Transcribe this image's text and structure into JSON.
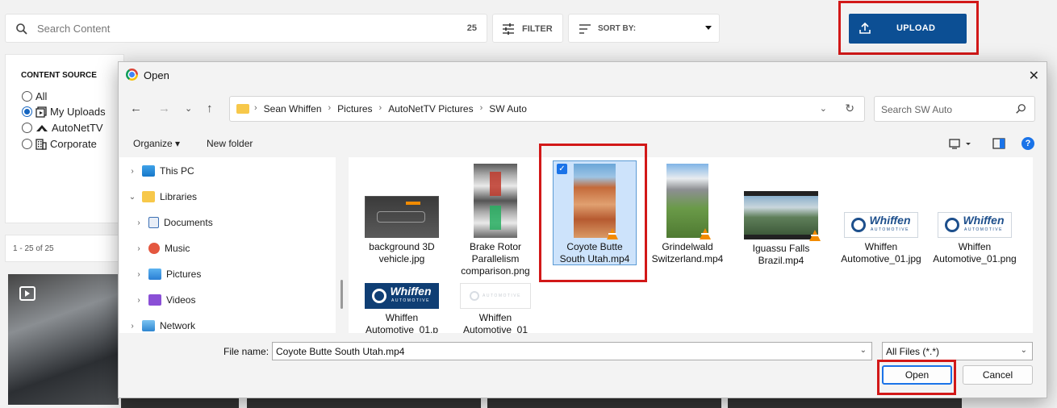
{
  "app": {
    "search": {
      "placeholder": "Search Content",
      "count": "25"
    },
    "filter_label": "FILTER",
    "sort_label": "SORT BY:",
    "upload_label": "UPLOAD",
    "content_source": {
      "title": "CONTENT SOURCE",
      "options": [
        {
          "label": "All",
          "selected": false,
          "icon": "none"
        },
        {
          "label": "My Uploads",
          "selected": true,
          "icon": "uploads-icon"
        },
        {
          "label": "AutoNetTV",
          "selected": false,
          "icon": "autonettv-icon"
        },
        {
          "label": "Corporate",
          "selected": false,
          "icon": "building-icon"
        }
      ]
    },
    "pager_text": "1 - 25 of 25"
  },
  "dialog": {
    "title": "Open",
    "breadcrumb": [
      "Sean Whiffen",
      "Pictures",
      "AutoNetTV Pictures",
      "SW Auto"
    ],
    "search_placeholder": "Search SW Auto",
    "organize_label": "Organize",
    "new_folder_label": "New folder",
    "help_label": "?",
    "nav_items": [
      {
        "label": "This PC",
        "expanded": false,
        "indent": 0,
        "icon": "monitor-icon"
      },
      {
        "label": "Libraries",
        "expanded": true,
        "indent": 0,
        "icon": "folder-icon"
      },
      {
        "label": "Documents",
        "expanded": false,
        "indent": 1,
        "icon": "documents-icon"
      },
      {
        "label": "Music",
        "expanded": false,
        "indent": 1,
        "icon": "music-icon"
      },
      {
        "label": "Pictures",
        "expanded": false,
        "indent": 1,
        "icon": "pictures-icon"
      },
      {
        "label": "Videos",
        "expanded": false,
        "indent": 1,
        "icon": "videos-icon"
      },
      {
        "label": "Network",
        "expanded": false,
        "indent": 0,
        "icon": "network-icon"
      }
    ],
    "files": [
      {
        "name": "background 3D vehicle.jpg",
        "selected": false
      },
      {
        "name": "Brake Rotor Parallelism comparison.png",
        "selected": false
      },
      {
        "name": "Coyote Butte South Utah.mp4",
        "selected": true
      },
      {
        "name": "Grindelwald Switzerland.mp4",
        "selected": false
      },
      {
        "name": "Iguassu Falls Brazil.mp4",
        "selected": false
      },
      {
        "name": "Whiffen Automotive_01.jpg",
        "selected": false
      },
      {
        "name": "Whiffen Automotive_01.png",
        "selected": false
      },
      {
        "name": "Whiffen Automotive_01.p",
        "selected": false
      },
      {
        "name": "Whiffen Automotive_01",
        "selected": false
      }
    ],
    "file_name_label": "File name:",
    "file_name_value": "Coyote Butte South Utah.mp4",
    "file_type": "All Files (*.*)",
    "open_label": "Open",
    "cancel_label": "Cancel"
  },
  "colors": {
    "upload_bg": "#0c4f94",
    "highlight": "#d21818",
    "selection": "#cde3fb",
    "accent": "#1a73e8"
  }
}
